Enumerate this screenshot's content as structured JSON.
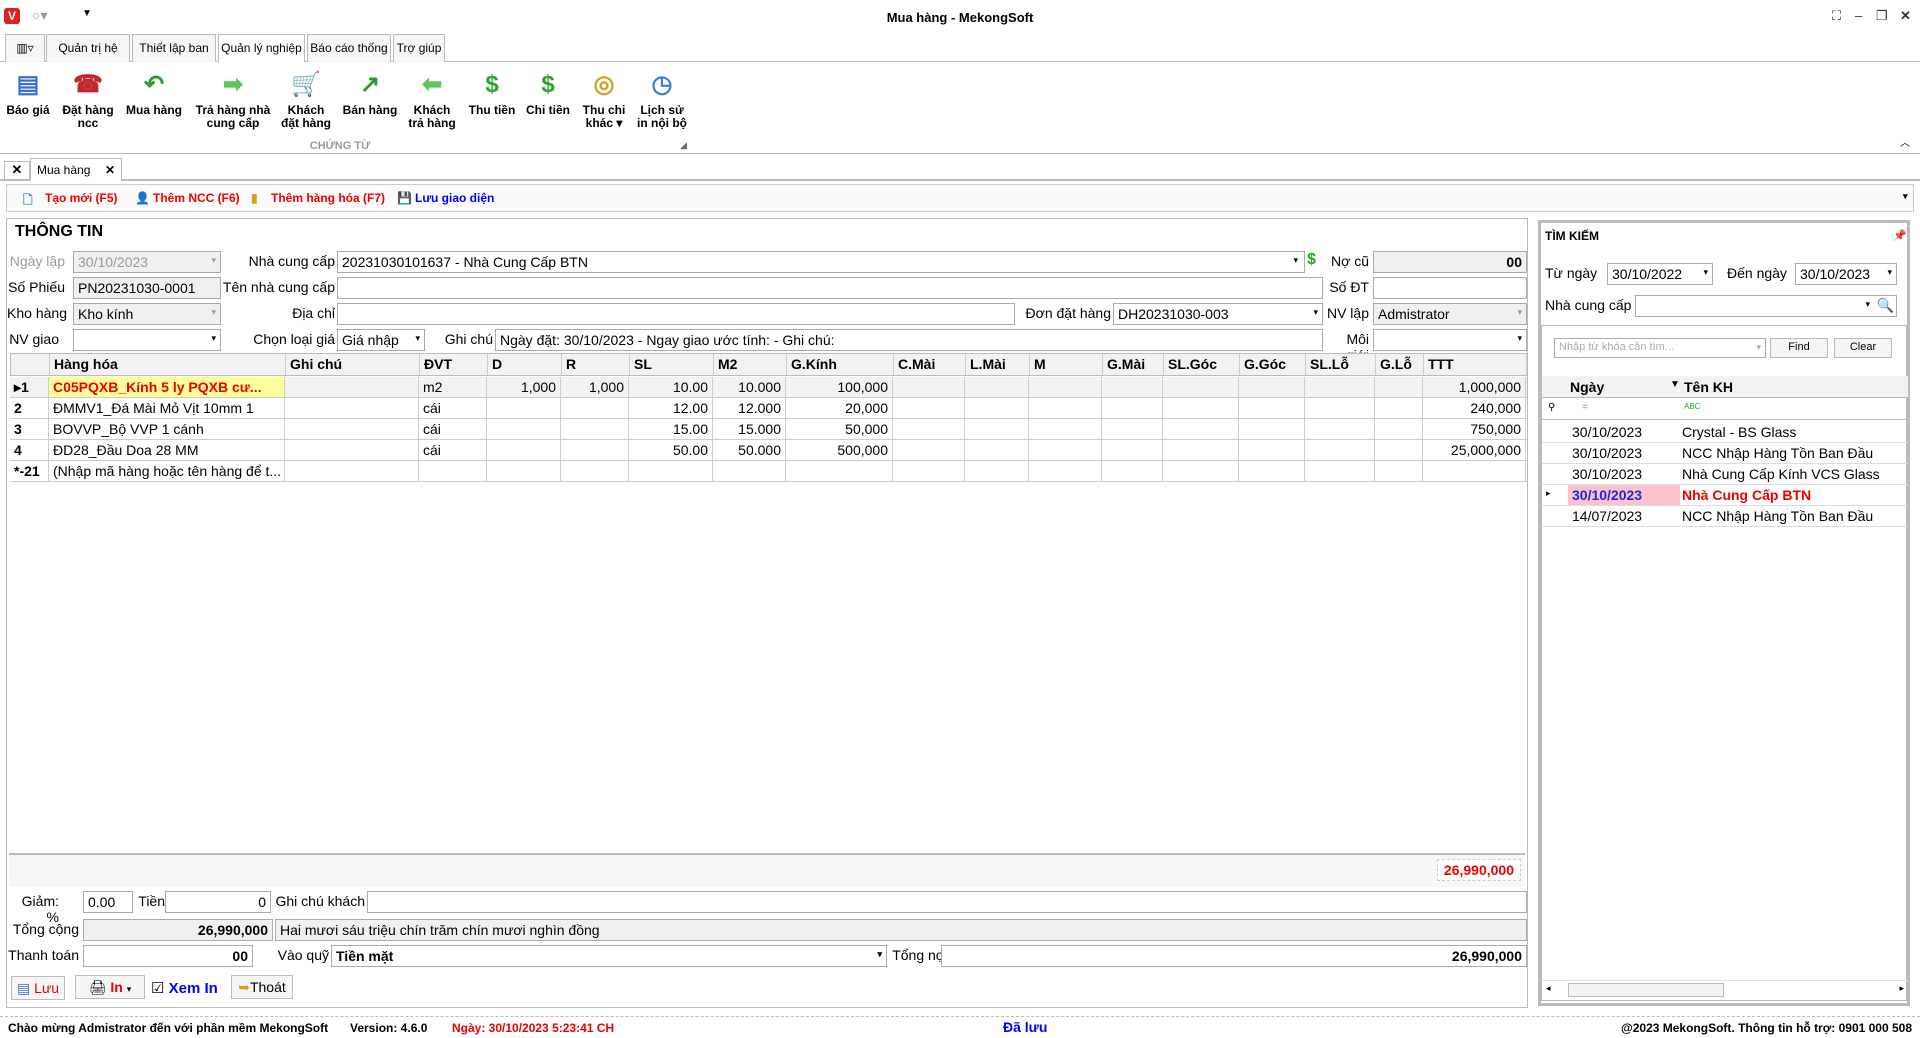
{
  "window": {
    "title": "Mua hàng - MekongSoft",
    "logo": "V"
  },
  "ribbon_tabs": [
    "Quản trị hệ thống",
    "Thiết lập ban đầu",
    "Quản lý nghiệp vụ",
    "Báo cáo thống kê",
    "Trợ giúp"
  ],
  "ribbon_buttons": [
    {
      "l1": "Báo giá",
      "l2": "",
      "icon": "quote-icon",
      "g": "▤",
      "c": "#3a6fd8"
    },
    {
      "l1": "Đặt hàng",
      "l2": "ncc",
      "icon": "telephone-icon",
      "g": "☎",
      "c": "#c0282d"
    },
    {
      "l1": "Mua hàng",
      "l2": "",
      "icon": "arrow-back-icon",
      "g": "↶",
      "c": "#2f9a2f"
    },
    {
      "l1": "Trả hàng nhà",
      "l2": "cung cấp",
      "icon": "arrow-right-icon",
      "g": "➡",
      "c": "#5cc65c"
    },
    {
      "l1": "Khách",
      "l2": "đặt hàng",
      "icon": "cart-icon",
      "g": "🛒",
      "c": "#666"
    },
    {
      "l1": "Bán hàng",
      "l2": "",
      "icon": "arrow-up-right-icon",
      "g": "↗",
      "c": "#2f9a2f"
    },
    {
      "l1": "Khách",
      "l2": "trả hàng",
      "icon": "arrow-left-icon",
      "g": "⬅",
      "c": "#5cc65c"
    },
    {
      "l1": "Thu tiền",
      "l2": "",
      "icon": "dollar-plus-icon",
      "g": "$",
      "c": "#2fa22f"
    },
    {
      "l1": "Chi tiền",
      "l2": "",
      "icon": "dollar-minus-icon",
      "g": "$",
      "c": "#2fa22f"
    },
    {
      "l1": "Thu chi",
      "l2": "khác ▾",
      "icon": "coins-icon",
      "g": "◎",
      "c": "#d4a020"
    },
    {
      "l1": "Lịch sử",
      "l2": "in nội bộ",
      "icon": "history-icon",
      "g": "◷",
      "c": "#3a7fd8"
    }
  ],
  "ribbon_group": "CHỨNG TỪ",
  "doc_tab": "Mua hàng",
  "toolbar": {
    "new": "Tạo mới (F5)",
    "add_supplier": "Thêm NCC (F6)",
    "add_goods": "Thêm hàng hóa (F7)",
    "save_layout": "Lưu giao diện"
  },
  "form": {
    "section": "THÔNG TIN",
    "date_label": "Ngày lập",
    "date": "30/10/2023",
    "supplier_label": "Nhà cung cấp",
    "supplier": "20231030101637 - Nhà Cung Cấp BTN",
    "old_debt_label": "Nợ cũ",
    "old_debt": "00",
    "voucher_label": "Số Phiếu",
    "voucher": "PN20231030-0001",
    "supplier_name_label": "Tên nhà cung cấp",
    "phone_label": "Số ĐT",
    "warehouse_label": "Kho hàng",
    "warehouse": "Kho kính",
    "address_label": "Địa chỉ",
    "order_label": "Đơn đặt hàng",
    "order": "DH20231030-003",
    "creator_label": "NV lập",
    "creator": "Admistrator",
    "deliverer_label": "NV giao",
    "price_type_label": "Chọn loại giá",
    "price_type": "Giá nhập",
    "note_label": "Ghi chú",
    "note": "Ngày đặt: 30/10/2023 - Ngay giao ước tính:  - Ghi chú:",
    "broker_label": "Môi giới"
  },
  "grid": {
    "columns": [
      "Hàng hóa",
      "Ghi chú",
      "ĐVT",
      "D",
      "R",
      "SL",
      "M2",
      "G.Kính",
      "C.Mài",
      "L.Mài",
      "M",
      "G.Mài",
      "SL.Góc",
      "G.Góc",
      "SL.Lỗ",
      "G.Lỗ",
      "TTT"
    ],
    "rows": [
      {
        "n": "1",
        "item": "C05PQXB_Kính 5 ly PQXB cư...",
        "unit": "m2",
        "d": "1,000",
        "r": "1,000",
        "sl": "10.00",
        "m2": "10.000",
        "price": "100,000",
        "ttt": "1,000,000"
      },
      {
        "n": "2",
        "item": "ĐMMV1_Đá Mài Mỏ Vịt 10mm 1",
        "unit": "cái",
        "d": "",
        "r": "",
        "sl": "12.00",
        "m2": "12.000",
        "price": "20,000",
        "ttt": "240,000"
      },
      {
        "n": "3",
        "item": "BOVVP_Bộ VVP 1 cánh",
        "unit": "cái",
        "d": "",
        "r": "",
        "sl": "15.00",
        "m2": "15.000",
        "price": "50,000",
        "ttt": "750,000"
      },
      {
        "n": "4",
        "item": "ĐD28_Đầu Doa 28 MM",
        "unit": "cái",
        "d": "",
        "r": "",
        "sl": "50.00",
        "m2": "50.000",
        "price": "500,000",
        "ttt": "25,000,000"
      }
    ],
    "new_row_num": "*-21",
    "new_row_placeholder": "(Nhập mã hàng hoặc tên hàng để t...",
    "footer_total": "26,990,000"
  },
  "totals": {
    "discount_label": "Giảm:  %",
    "discount_pct": "0.00",
    "money_label": "Tiền",
    "money": "0",
    "customer_note_label": "Ghi chú khách",
    "total_label": "Tổng cộng",
    "total": "26,990,000",
    "total_words": "Hai mươi sáu triệu chín trăm chín mươi nghìn đồng",
    "paid_label": "Thanh toán",
    "paid": "00",
    "fund_label": "Vào quỹ",
    "fund": "Tiền mặt",
    "debt_label": "Tổng nợ",
    "debt": "26,990,000"
  },
  "actions": {
    "save": "Lưu",
    "print": "In",
    "preview": "Xem In",
    "exit": "Thoát"
  },
  "search": {
    "title": "TÌM KIẾM",
    "from_label": "Từ ngày",
    "from": "30/10/2022",
    "to_label": "Đến ngày",
    "to": "30/10/2023",
    "supplier_label": "Nhà cung cấp",
    "keyword_placeholder": "Nhập từ khóa cần tìm...",
    "find": "Find",
    "clear": "Clear",
    "col_date": "Ngày",
    "col_name": "Tên KH",
    "filter_eq": "=",
    "filter_abc": "ABC",
    "rows": [
      {
        "date": "30/10/2023",
        "name": "Crystal - BS Glass"
      },
      {
        "date": "30/10/2023",
        "name": "NCC Nhập Hàng Tồn Ban Đầu"
      },
      {
        "date": "30/10/2023",
        "name": "Nhà Cung Cấp Kính VCS Glass"
      },
      {
        "date": "30/10/2023",
        "name": "Nhà Cung Cấp BTN"
      },
      {
        "date": "14/07/2023",
        "name": "NCC Nhập Hàng Tồn Ban Đầu"
      }
    ],
    "selected_index": 3
  },
  "status": {
    "welcome": "Chào mừng Admistrator đến với phần mềm MekongSoft",
    "version": "Version: 4.6.0",
    "date": "Ngày: 30/10/2023 5:23:41 CH",
    "saved": "Đã lưu",
    "copyright": "@2023 MekongSoft. Thông tin hỗ trợ: 0901 000 508"
  }
}
